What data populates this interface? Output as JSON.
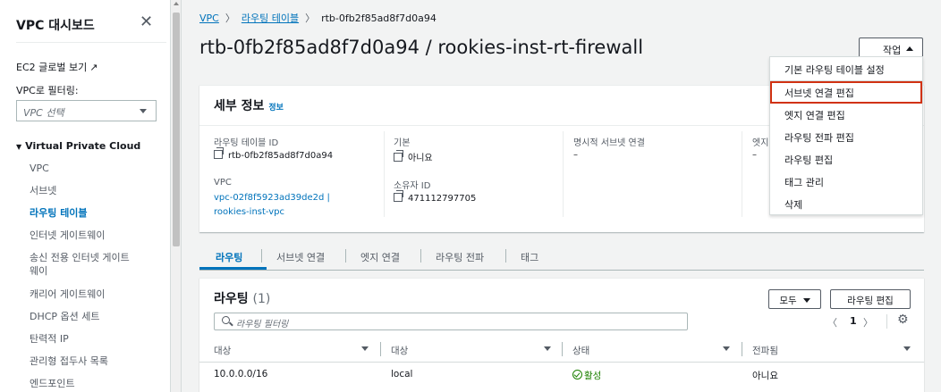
{
  "sidebar": {
    "title": "VPC 대시보드",
    "ec2_global_view": "EC2 글로벌 보기",
    "filter_label": "VPC로 필터링:",
    "filter_placeholder": "VPC 선택",
    "section": "Virtual Private Cloud",
    "items": [
      "VPC",
      "서브넷",
      "라우팅 테이블",
      "인터넷 게이트웨이",
      "송신 전용 인터넷 게이트\n웨이",
      "캐리어 게이트웨이",
      "DHCP 옵션 세트",
      "탄력적 IP",
      "관리형 접두사 목록",
      "엔드포인트"
    ],
    "active_index": 2
  },
  "breadcrumb": {
    "vpc": "VPC",
    "route_tables": "라우팅 테이블",
    "current": "rtb-0fb2f85ad8f7d0a94"
  },
  "page_title": "rtb-0fb2f85ad8f7d0a94 / rookies-inst-rt-firewall",
  "actions_label": "작업",
  "actions_menu": [
    "기본 라우팅 테이블 설정",
    "서브넷 연결 편집",
    "엣지 연결 편집",
    "라우팅 전파 편집",
    "라우팅 편집",
    "태그 관리",
    "삭제"
  ],
  "details": {
    "title": "세부 정보",
    "info": "정보",
    "route_table_id_label": "라우팅 테이블 ID",
    "route_table_id": "rtb-0fb2f85ad8f7d0a94",
    "main_label": "기본",
    "main_value": "아니요",
    "explicit_subnet_label": "명시적 서브넷 연결",
    "explicit_subnet_value": "–",
    "edge_label": "엣지",
    "edge_value": "–",
    "vpc_label": "VPC",
    "vpc_value": "vpc-02f8f5923ad39de2d | rookies-inst-vpc",
    "owner_label": "소유자 ID",
    "owner_value": "471112797705"
  },
  "tabs": [
    "라우팅",
    "서브넷 연결",
    "엣지 연결",
    "라우팅 전파",
    "태그"
  ],
  "routes": {
    "title": "라우팅",
    "count": "(1)",
    "filter_select": "모두",
    "edit_button": "라우팅 편집",
    "filter_placeholder": "라우팅 필터링",
    "page": "1",
    "prev": "〈",
    "next": "〉",
    "gear": "⚙",
    "columns": [
      "대상",
      "대상",
      "상태",
      "전파됨"
    ],
    "rows": [
      {
        "destination": "10.0.0.0/16",
        "target": "local",
        "status": "활성",
        "propagated": "아니요"
      }
    ]
  },
  "colors": {
    "link": "#0073bb",
    "highlight": "#d13212",
    "success": "#1d8102"
  }
}
